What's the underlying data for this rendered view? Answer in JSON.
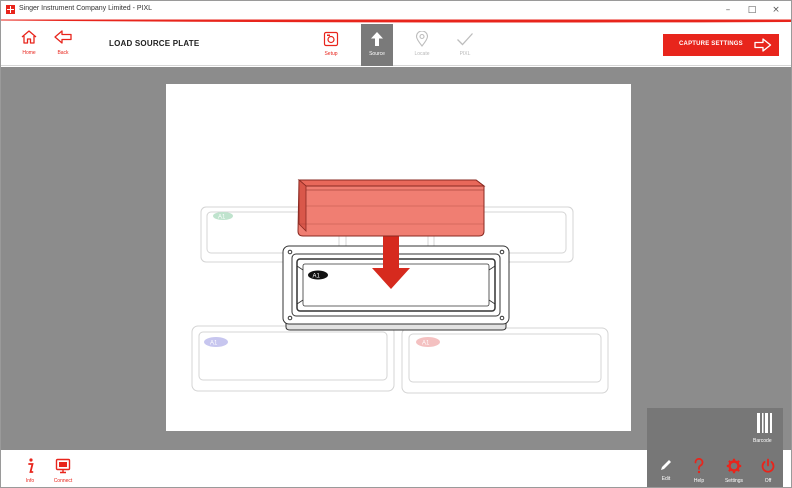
{
  "window": {
    "title": "Singer Instrument Company Limited - PIXL",
    "controls": {
      "minimize": "–",
      "maximize": "□",
      "close": "×"
    }
  },
  "colors": {
    "accent": "#e8251c",
    "toolbar_active": "#7a7a7a",
    "canvas_bg": "#8c8c8c",
    "dark_tile": "#777777"
  },
  "toolbar": {
    "home_label": "Home",
    "back_label": "Back",
    "page_title": "LOAD SOURCE PLATE",
    "steps": [
      {
        "label": "Setup",
        "icon": "camera-settings-icon",
        "state": "done"
      },
      {
        "label": "Source",
        "icon": "upload-arrow-icon",
        "state": "active"
      },
      {
        "label": "Locate",
        "icon": "location-pin-icon",
        "state": "pending"
      },
      {
        "label": "PIXL",
        "icon": "checkmark-icon",
        "state": "pending"
      }
    ],
    "capture_label": "CAPTURE SETTINGS"
  },
  "illustration": {
    "description_icons": [
      "source-plate-holder",
      "petri-dish"
    ],
    "plate_labels": [
      "A1",
      "A1",
      "A1",
      "A1",
      "A1"
    ]
  },
  "barcode": {
    "label": "Barcode",
    "icon": "barcode-icon"
  },
  "bottombar": {
    "info_label": "Info",
    "connect_label": "Connect",
    "edit_label": "Edit",
    "help_label": "Help",
    "settings_label": "Settings",
    "off_label": "Off"
  }
}
